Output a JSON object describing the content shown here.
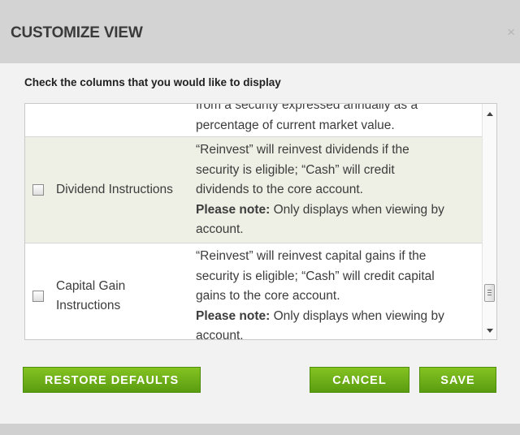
{
  "dialog": {
    "title": "CUSTOMIZE VIEW",
    "close_glyph": "×",
    "instruction": "Check the columns that you would like to display"
  },
  "rows": [
    {
      "name": "",
      "checked": false,
      "desc_lines": [
        "from a security expressed annually as a",
        "percentage of current market value."
      ]
    },
    {
      "name": "Dividend Instructions",
      "checked": false,
      "desc_lines": [
        "“Reinvest” will reinvest dividends if the",
        "security is eligible; “Cash” will credit",
        "dividends to the core account."
      ],
      "note_label": "Please note:",
      "note_text": " Only displays when viewing by",
      "note_cont": "account."
    },
    {
      "name_lines": [
        "Capital Gain",
        "Instructions"
      ],
      "checked": false,
      "desc_lines": [
        "“Reinvest” will reinvest capital gains if the",
        "security is eligible; “Cash” will credit capital",
        "gains to the core account."
      ],
      "note_label": "Please note:",
      "note_text": " Only displays when viewing by",
      "note_cont": "account."
    }
  ],
  "buttons": {
    "restore": "RESTORE DEFAULTS",
    "cancel": "CANCEL",
    "save": "SAVE"
  },
  "icons": [
    "close-icon",
    "scroll-up-arrow-icon",
    "scroll-down-arrow-icon",
    "checkbox-icon"
  ],
  "colors": {
    "button_green": "#6fb01a",
    "title_bar": "#d3d3d3",
    "alt_row": "#eef0e5"
  }
}
